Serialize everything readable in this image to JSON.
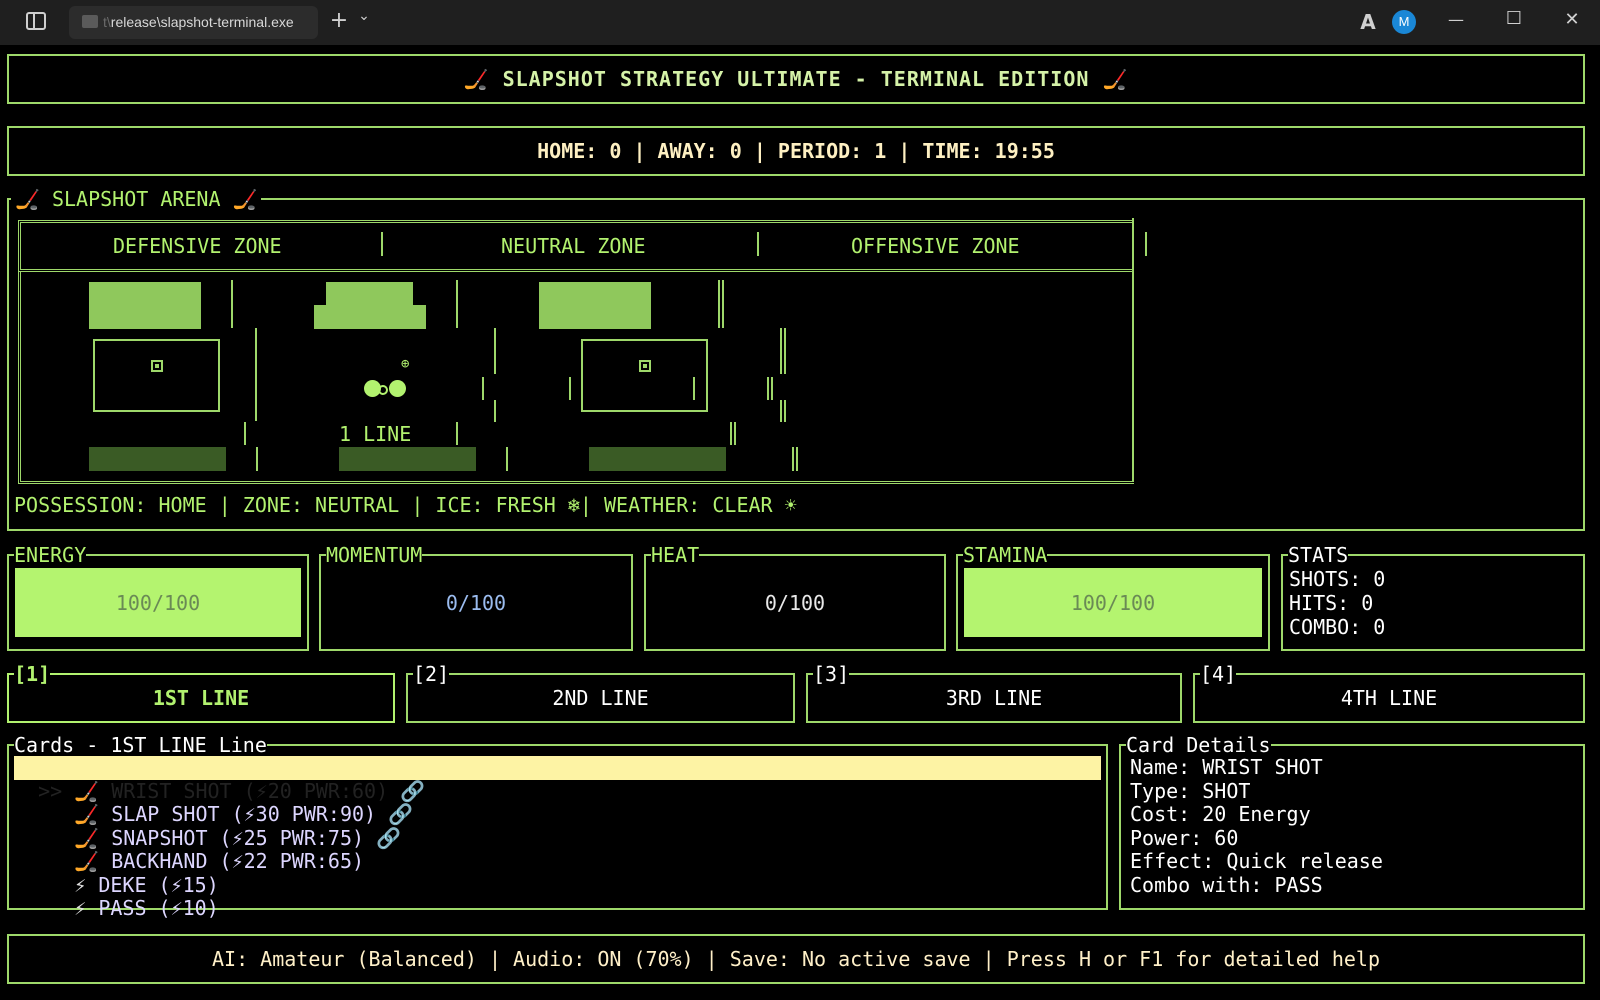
{
  "window": {
    "tab_prefix": "t\\",
    "tab_title": "release\\slapshot-terminal.exe",
    "new_tab": "+",
    "dropdown": "⌄",
    "avatar": "M",
    "minimize": "—",
    "maximize": "☐",
    "close": "✕"
  },
  "title": "🏒 SLAPSHOT STRATEGY ULTIMATE - TERMINAL EDITION 🏒",
  "scoreboard": "HOME: 0 | AWAY: 0 | PERIOD: 1 | TIME: 19:55",
  "arena": {
    "label": "🏒 SLAPSHOT ARENA 🏒",
    "zones": [
      "DEFENSIVE ZONE",
      "NEUTRAL ZONE",
      "OFFENSIVE ZONE"
    ],
    "line_label": "1 LINE",
    "target_glyph": "⊕",
    "status": "POSSESSION: HOME | ZONE: NEUTRAL | ICE: FRESH ❄| WEATHER: CLEAR ☀"
  },
  "meters": [
    {
      "label": "ENERGY",
      "value": "100/100",
      "fill": 1.0
    },
    {
      "label": "MOMENTUM",
      "value": "0/100",
      "fill": 0.0
    },
    {
      "label": "HEAT",
      "value": "0/100",
      "fill": 0.0
    },
    {
      "label": "STAMINA",
      "value": "100/100",
      "fill": 1.0
    }
  ],
  "stats": {
    "label": "STATS",
    "shots": "SHOTS: 0",
    "hits": "HITS: 0",
    "combo": "COMBO: 0"
  },
  "lines": [
    {
      "key": "[1]",
      "label": "1ST LINE",
      "selected": true
    },
    {
      "key": "[2]",
      "label": "2ND LINE",
      "selected": false
    },
    {
      "key": "[3]",
      "label": "3RD LINE",
      "selected": false
    },
    {
      "key": "[4]",
      "label": "4TH LINE",
      "selected": false
    }
  ],
  "cards": {
    "label": "Cards - 1ST LINE Line",
    "items": [
      {
        "pointer": ">>",
        "icon": "🏒",
        "text": "WRIST SHOT (⚡20 PWR:60)",
        "combo": "🔗",
        "selected": true
      },
      {
        "pointer": "  ",
        "icon": "🏒",
        "text": "SLAP SHOT (⚡30 PWR:90)",
        "combo": "🔗",
        "selected": false
      },
      {
        "pointer": "  ",
        "icon": "🏒",
        "text": "SNAPSHOT (⚡25 PWR:75)",
        "combo": "🔗",
        "selected": false
      },
      {
        "pointer": "  ",
        "icon": "🏒",
        "text": "BACKHAND (⚡22 PWR:65)",
        "combo": "",
        "selected": false
      },
      {
        "pointer": "  ",
        "icon": "⚡",
        "text": "DEKE (⚡15)",
        "combo": "",
        "selected": false
      },
      {
        "pointer": "  ",
        "icon": "⚡",
        "text": "PASS (⚡10)",
        "combo": "",
        "selected": false
      }
    ]
  },
  "details": {
    "label": "Card Details",
    "name": "Name: WRIST SHOT",
    "type": "Type: SHOT",
    "cost": "Cost: 20 Energy",
    "power": "Power: 60",
    "effect": "Effect: Quick release",
    "combo": "Combo with: PASS"
  },
  "footer": "AI: Amateur (Balanced) | Audio: ON (70%) | Save: No active save | Press H or F1 for detailed help"
}
